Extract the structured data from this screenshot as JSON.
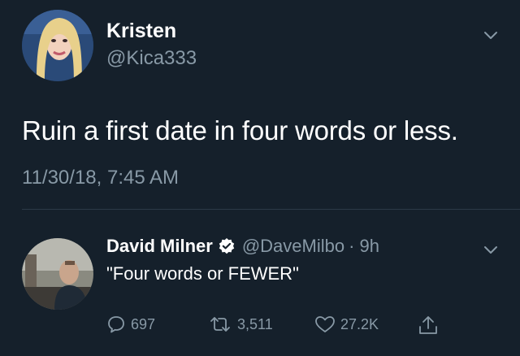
{
  "tweet": {
    "author_name": "Kristen",
    "author_handle": "@Kica333",
    "text": "Ruin a first date in four words or less.",
    "timestamp": "11/30/18, 7:45 AM"
  },
  "reply": {
    "author_name": "David Milner",
    "author_handle": "@DaveMilbo",
    "time": "· 9h",
    "text": "\"Four words or FEWER\"",
    "verified": true,
    "stats": {
      "replies": "697",
      "retweets": "3,511",
      "likes": "27.2K"
    }
  },
  "colors": {
    "background": "#15202b",
    "muted": "#8899a6",
    "verified_badge": "#ffffff"
  },
  "icons": [
    "chevron-down-icon",
    "verified-badge-icon",
    "reply-icon",
    "retweet-icon",
    "like-icon",
    "share-icon"
  ]
}
